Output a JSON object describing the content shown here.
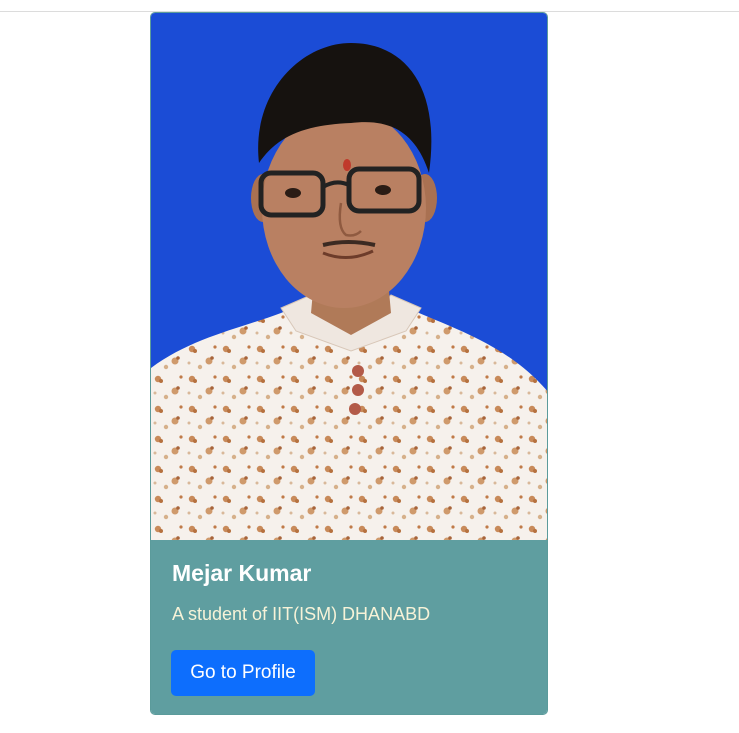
{
  "card": {
    "image_alt": "Mejar Kumar",
    "title": "Mejar Kumar",
    "description": "A student of IIT(ISM) DHANABD",
    "button_label": "Go to Profile"
  },
  "colors": {
    "photo_background": "#1b4cd6",
    "card_body": "#5f9ea0",
    "button": "#0d6efd",
    "title_text": "#ffffff",
    "description_text": "#f7f3d8"
  }
}
